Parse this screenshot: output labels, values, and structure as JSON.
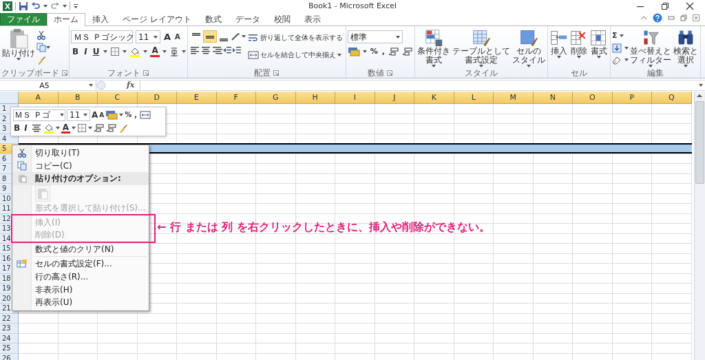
{
  "window": {
    "title": "Book1 - Microsoft Excel"
  },
  "tabs": [
    {
      "label": "ファイル",
      "kind": "file",
      "selected": false
    },
    {
      "label": "ホーム",
      "kind": "tab",
      "selected": true
    },
    {
      "label": "挿入",
      "kind": "tab",
      "selected": false
    },
    {
      "label": "ページ レイアウト",
      "kind": "tab",
      "selected": false
    },
    {
      "label": "数式",
      "kind": "tab",
      "selected": false
    },
    {
      "label": "データ",
      "kind": "tab",
      "selected": false
    },
    {
      "label": "校閲",
      "kind": "tab",
      "selected": false
    },
    {
      "label": "表示",
      "kind": "tab",
      "selected": false
    }
  ],
  "ribbon": {
    "groups": [
      {
        "kind": "clipboard",
        "label": "クリップボード",
        "launcher": true,
        "paste_label": "貼り付け"
      },
      {
        "kind": "font",
        "label": "フォント",
        "launcher": true,
        "font_name": "ＭＳ Ｐゴシック",
        "font_size": "11",
        "grow_font": "A",
        "shrink_font": "A",
        "style_buttons": [
          "B",
          "I",
          "U"
        ],
        "font_color": "A"
      },
      {
        "kind": "alignment",
        "label": "配置",
        "launcher": true,
        "valign_buttons": [
          {
            "selected": false
          },
          {
            "selected": true
          },
          {
            "selected": false
          }
        ],
        "wrap_text": "折り返して全体を表示する",
        "merge": "セルを結合して中央揃え"
      },
      {
        "kind": "number",
        "label": "数値",
        "launcher": true,
        "format": "標準",
        "percent": "%",
        "comma": ","
      },
      {
        "kind": "styles",
        "label": "スタイル",
        "launcher": false,
        "buttons": [
          {
            "lines": [
              "条件付き",
              "書式"
            ]
          },
          {
            "lines": [
              "テーブルとして",
              "書式設定"
            ]
          },
          {
            "lines": [
              "セルの",
              "スタイル"
            ]
          }
        ]
      },
      {
        "kind": "cells",
        "label": "セル",
        "launcher": false,
        "buttons": [
          {
            "lines": [
              "挿入"
            ]
          },
          {
            "lines": [
              "削除"
            ]
          },
          {
            "lines": [
              "書式"
            ]
          }
        ]
      },
      {
        "kind": "editing",
        "label": "編集",
        "launcher": false,
        "sum": "Σ",
        "buttons": [
          {
            "lines": [
              "並べ替えと",
              "フィルター"
            ]
          },
          {
            "lines": [
              "検索と",
              "選択"
            ]
          }
        ]
      }
    ]
  },
  "formula_bar": {
    "name_box": "A5",
    "function_label": "fx"
  },
  "sheet": {
    "columns_highlighted": true,
    "columns": [
      "A",
      "B",
      "C",
      "D",
      "E",
      "F",
      "G",
      "H",
      "I",
      "J",
      "K",
      "L",
      "M",
      "N",
      "O",
      "P",
      "Q"
    ],
    "rows": [
      {
        "label": "1",
        "selected": false
      },
      {
        "label": "2",
        "selected": false
      },
      {
        "label": "3",
        "selected": false
      },
      {
        "label": "4",
        "selected": false
      },
      {
        "label": "5",
        "selected": true
      },
      {
        "label": "6",
        "selected": false
      },
      {
        "label": "7",
        "selected": false
      },
      {
        "label": "8",
        "selected": false
      },
      {
        "label": "9",
        "selected": false
      },
      {
        "label": "10",
        "selected": false
      },
      {
        "label": "11",
        "selected": false
      },
      {
        "label": "12",
        "selected": false
      },
      {
        "label": "13",
        "selected": false
      },
      {
        "label": "14",
        "selected": false
      },
      {
        "label": "15",
        "selected": false
      },
      {
        "label": "16",
        "selected": false
      },
      {
        "label": "17",
        "selected": false
      },
      {
        "label": "18",
        "selected": false
      },
      {
        "label": "19",
        "selected": false
      },
      {
        "label": "20",
        "selected": false
      },
      {
        "label": "21",
        "selected": false
      },
      {
        "label": "22",
        "selected": false
      },
      {
        "label": "23",
        "selected": false
      },
      {
        "label": "24",
        "selected": false
      },
      {
        "label": "25",
        "selected": false
      },
      {
        "label": "26",
        "selected": false
      }
    ]
  },
  "mini_toolbar": {
    "font_name": "ＭＳ Ｐゴ",
    "font_size": "11",
    "grow_font": "A",
    "shrink_font": "A",
    "percent": "%",
    "comma": ",",
    "bold": "B",
    "italic": "I",
    "font_color": "A"
  },
  "context_menu": {
    "items": [
      {
        "kind": "command",
        "label": "切り取り(T)",
        "disabled": false,
        "callout": false
      },
      {
        "kind": "command",
        "label": "コピー(C)",
        "disabled": false,
        "callout": false
      },
      {
        "kind": "header",
        "label": "貼り付けのオプション:",
        "disabled": false,
        "callout": false
      },
      {
        "kind": "paste_buttons",
        "disabled": true,
        "callout": false
      },
      {
        "kind": "command",
        "label": "形式を選択して貼り付け(S)...",
        "disabled": true,
        "callout": false
      },
      {
        "kind": "command",
        "label": "挿入(I)",
        "disabled": true,
        "callout": true
      },
      {
        "kind": "command",
        "label": "削除(D)",
        "disabled": true,
        "callout": true
      },
      {
        "kind": "command",
        "label": "数式と値のクリア(N)",
        "disabled": false,
        "callout": false
      },
      {
        "kind": "separator"
      },
      {
        "kind": "command",
        "label": "セルの書式設定(F)...",
        "disabled": false,
        "callout": false
      },
      {
        "kind": "command",
        "label": "行の高さ(R)...",
        "disabled": false,
        "callout": false
      },
      {
        "kind": "command",
        "label": "非表示(H)",
        "disabled": false,
        "callout": false
      },
      {
        "kind": "command",
        "label": "再表示(U)",
        "disabled": false,
        "callout": false
      }
    ]
  },
  "annotation": {
    "text": "← 行 または 列 を右クリックしたときに、挿入や削除ができない。",
    "color": "#e0207a"
  }
}
